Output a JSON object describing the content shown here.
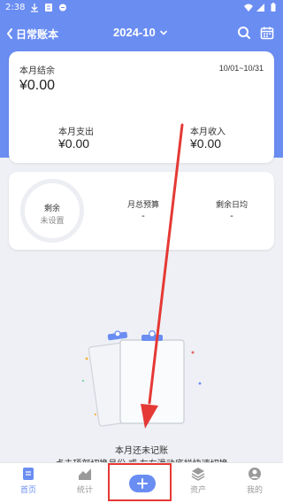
{
  "status_bar": {
    "time": "2:38"
  },
  "header": {
    "app_title": "日常账本",
    "month": "2024-10"
  },
  "summary": {
    "balance_label": "本月结余",
    "balance_value": "¥0.00",
    "date_range": "10/01~10/31",
    "expense_label": "本月支出",
    "expense_value": "¥0.00",
    "income_label": "本月收入",
    "income_value": "¥0.00"
  },
  "budget": {
    "ring_label": "剩余",
    "ring_status": "未设置",
    "monthly_budget_label": "月总预算",
    "monthly_budget_value": "-",
    "daily_remaining_label": "剩余日均",
    "daily_remaining_value": "-"
  },
  "empty_state": {
    "title": "本月还未记账",
    "hint": "点击顶部切换月份 或 左右滑动底栏快速切换"
  },
  "tabbar": {
    "tabs": [
      {
        "label": "首页",
        "icon": "home-icon",
        "active": true
      },
      {
        "label": "统计",
        "icon": "chart-icon",
        "active": false
      },
      {
        "label": "资产",
        "icon": "layers-icon",
        "active": false
      },
      {
        "label": "我的",
        "icon": "profile-icon",
        "active": false
      }
    ],
    "add_icon": "plus-icon"
  },
  "colors": {
    "accent": "#6a8df2",
    "annotation": "#e53935",
    "background": "#eef0f5"
  }
}
